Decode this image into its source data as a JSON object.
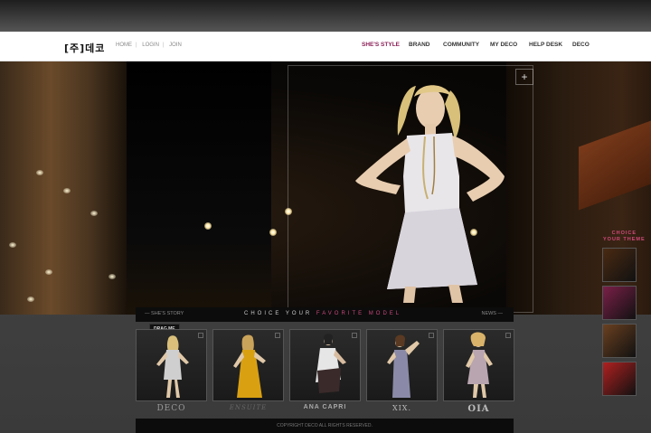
{
  "header": {
    "logo": "[주]데코",
    "util_links": [
      "HOME",
      "LOGIN",
      "JOIN"
    ],
    "nav": [
      {
        "label": "SHE'S STYLE",
        "active": true
      },
      {
        "label": "BRAND",
        "active": false
      },
      {
        "label": "COMMUNITY",
        "active": false
      },
      {
        "label": "MY DECO",
        "active": false
      },
      {
        "label": "HELP DESK",
        "active": false
      },
      {
        "label": "DECO",
        "active": false
      }
    ]
  },
  "hero": {
    "plus_label": "+",
    "theme_label": [
      "CHOICE",
      "YOUR THEME"
    ]
  },
  "choice_bar": {
    "left_link": "— SHE'S STORY",
    "title_part1": "CHOICE   YOUR",
    "title_part2": "FAVORITE MODEL",
    "right_link": "NEWS —"
  },
  "drag_label": "DRAG ME",
  "brands": [
    {
      "name": "DECO",
      "color": "#cfcfcf"
    },
    {
      "name": "ENSUITE",
      "color": "#d9a012"
    },
    {
      "name": "ANA CAPRI",
      "color": "#e6e6e6"
    },
    {
      "name": "XIX.",
      "color": "#8a8aa8"
    },
    {
      "name": "OIA",
      "color": "#b9a5b0"
    }
  ],
  "theme_colors": [
    "#4a2a12",
    "#7a2048",
    "#6a4020",
    "#b02020"
  ],
  "footer": "COPYRIGHT DECO ALL RIGHTS RESERVED."
}
